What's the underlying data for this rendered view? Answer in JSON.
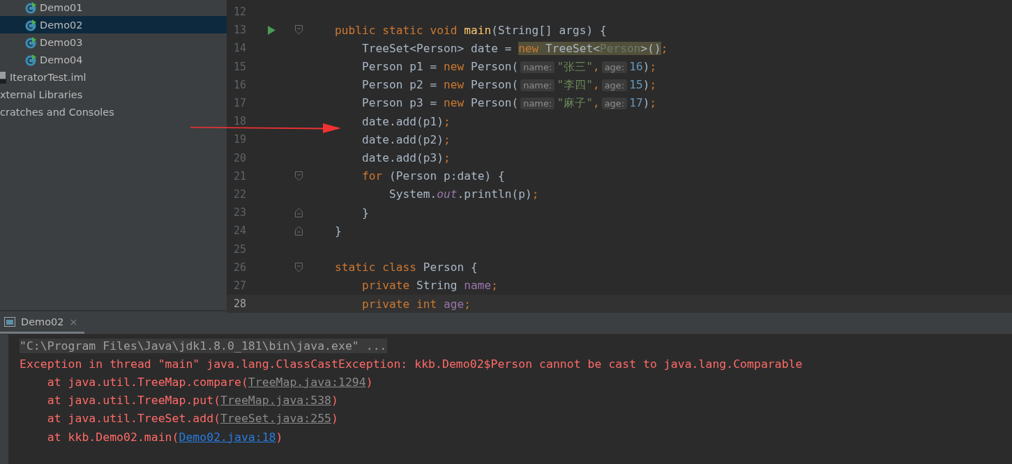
{
  "project_tree": {
    "items": [
      {
        "label": "Demo01",
        "kind": "class",
        "selected": false
      },
      {
        "label": "Demo02",
        "kind": "class",
        "selected": true
      },
      {
        "label": "Demo03",
        "kind": "class",
        "selected": false
      },
      {
        "label": "Demo04",
        "kind": "class",
        "selected": false
      },
      {
        "label": "IteratorTest.iml",
        "kind": "module-file",
        "selected": false
      },
      {
        "label": "xternal Libraries",
        "kind": "library",
        "selected": false
      },
      {
        "label": "cratches and Consoles",
        "kind": "scratches",
        "selected": false
      }
    ]
  },
  "editor": {
    "lines": [
      {
        "number": "12",
        "current": false
      },
      {
        "number": "13",
        "run": true,
        "fold_start": true,
        "current": false,
        "tokens": [
          {
            "kind": "kw",
            "text": "    public static void "
          },
          {
            "kind": "fn",
            "text": "main"
          },
          {
            "kind": "txt",
            "text": "(String[] args) {"
          }
        ]
      },
      {
        "number": "14",
        "current": false,
        "tokens": [
          {
            "kind": "txt",
            "text": "        TreeSet<Person> date = "
          },
          {
            "kind": "kw-hl",
            "text": "new"
          },
          {
            "kind": "txt-hl",
            "text": " TreeSet<"
          },
          {
            "kind": "gen-hl",
            "text": "Person"
          },
          {
            "kind": "txt-hl",
            "text": ">()"
          },
          {
            "kind": "kw",
            "text": ";"
          }
        ]
      },
      {
        "number": "15",
        "current": false,
        "tokens": [
          {
            "kind": "txt",
            "text": "        Person p1 = "
          },
          {
            "kind": "kw",
            "text": "new"
          },
          {
            "kind": "txt",
            "text": " Person("
          },
          {
            "kind": "hint",
            "text": "name:"
          },
          {
            "kind": "str",
            "text": "\"张三\""
          },
          {
            "kind": "kw",
            "text": ","
          },
          {
            "kind": "hint",
            "text": "age:"
          },
          {
            "kind": "num",
            "text": "16"
          },
          {
            "kind": "txt",
            "text": ")"
          },
          {
            "kind": "kw",
            "text": ";"
          }
        ]
      },
      {
        "number": "16",
        "current": false,
        "tokens": [
          {
            "kind": "txt",
            "text": "        Person p2 = "
          },
          {
            "kind": "kw",
            "text": "new"
          },
          {
            "kind": "txt",
            "text": " Person("
          },
          {
            "kind": "hint",
            "text": "name:"
          },
          {
            "kind": "str",
            "text": "\"李四\""
          },
          {
            "kind": "kw",
            "text": ","
          },
          {
            "kind": "hint",
            "text": "age:"
          },
          {
            "kind": "num",
            "text": "15"
          },
          {
            "kind": "txt",
            "text": ")"
          },
          {
            "kind": "kw",
            "text": ";"
          }
        ]
      },
      {
        "number": "17",
        "current": false,
        "tokens": [
          {
            "kind": "txt",
            "text": "        Person p3 = "
          },
          {
            "kind": "kw",
            "text": "new"
          },
          {
            "kind": "txt",
            "text": " Person("
          },
          {
            "kind": "hint",
            "text": "name:"
          },
          {
            "kind": "str",
            "text": "\"麻子\""
          },
          {
            "kind": "kw",
            "text": ","
          },
          {
            "kind": "hint",
            "text": "age:"
          },
          {
            "kind": "num",
            "text": "17"
          },
          {
            "kind": "txt",
            "text": ")"
          },
          {
            "kind": "kw",
            "text": ";"
          }
        ]
      },
      {
        "number": "18",
        "current": false,
        "tokens": [
          {
            "kind": "txt",
            "text": "        date.add(p1)"
          },
          {
            "kind": "kw",
            "text": ";"
          }
        ]
      },
      {
        "number": "19",
        "current": false,
        "tokens": [
          {
            "kind": "txt",
            "text": "        date.add(p2)"
          },
          {
            "kind": "kw",
            "text": ";"
          }
        ]
      },
      {
        "number": "20",
        "current": false,
        "tokens": [
          {
            "kind": "txt",
            "text": "        date.add(p3)"
          },
          {
            "kind": "kw",
            "text": ";"
          }
        ]
      },
      {
        "number": "21",
        "fold_start": true,
        "current": false,
        "tokens": [
          {
            "kind": "kw",
            "text": "        for"
          },
          {
            "kind": "txt",
            "text": " (Person p:date) {"
          }
        ]
      },
      {
        "number": "22",
        "current": false,
        "tokens": [
          {
            "kind": "txt",
            "text": "            System."
          },
          {
            "kind": "static",
            "text": "out"
          },
          {
            "kind": "txt",
            "text": ".println(p)"
          },
          {
            "kind": "kw",
            "text": ";"
          }
        ]
      },
      {
        "number": "23",
        "fold_end": true,
        "current": false,
        "tokens": [
          {
            "kind": "txt",
            "text": "        }"
          }
        ]
      },
      {
        "number": "24",
        "fold_end": true,
        "current": false,
        "tokens": [
          {
            "kind": "txt",
            "text": "    }"
          }
        ]
      },
      {
        "number": "25",
        "current": false
      },
      {
        "number": "26",
        "fold_start": true,
        "current": false,
        "tokens": [
          {
            "kind": "kw",
            "text": "    static class "
          },
          {
            "kind": "txt",
            "text": "Person {"
          }
        ]
      },
      {
        "number": "27",
        "current": false,
        "tokens": [
          {
            "kind": "kw",
            "text": "        private "
          },
          {
            "kind": "txt",
            "text": "String "
          },
          {
            "kind": "field",
            "text": "name"
          },
          {
            "kind": "kw",
            "text": ";"
          }
        ]
      },
      {
        "number": "28",
        "current": true,
        "tokens": [
          {
            "kind": "kw",
            "text": "        private int "
          },
          {
            "kind": "field",
            "text": "age"
          },
          {
            "kind": "kw",
            "text": ";"
          }
        ]
      }
    ]
  },
  "run_panel": {
    "tab": {
      "label": "Demo02",
      "close": "×",
      "selected": true
    },
    "lines": [
      {
        "kind": "command",
        "text": "\"C:\\Program Files\\Java\\jdk1.8.0_181\\bin\\java.exe\" ..."
      },
      {
        "kind": "error",
        "text": "Exception in thread \"main\" java.lang.ClassCastException: kkb.Demo02$Person cannot be cast to java.lang.Comparable"
      },
      {
        "kind": "trace",
        "prefix": "    at java.util.TreeMap.compare(",
        "link": "TreeMap.java:1294",
        "project_link": false,
        "suffix": ")"
      },
      {
        "kind": "trace",
        "prefix": "    at java.util.TreeMap.put(",
        "link": "TreeMap.java:538",
        "project_link": false,
        "suffix": ")"
      },
      {
        "kind": "trace",
        "prefix": "    at java.util.TreeSet.add(",
        "link": "TreeSet.java:255",
        "project_link": false,
        "suffix": ")"
      },
      {
        "kind": "trace",
        "prefix": "    at kkb.Demo02.main(",
        "link": "Demo02.java:18",
        "project_link": true,
        "suffix": ")"
      }
    ]
  }
}
